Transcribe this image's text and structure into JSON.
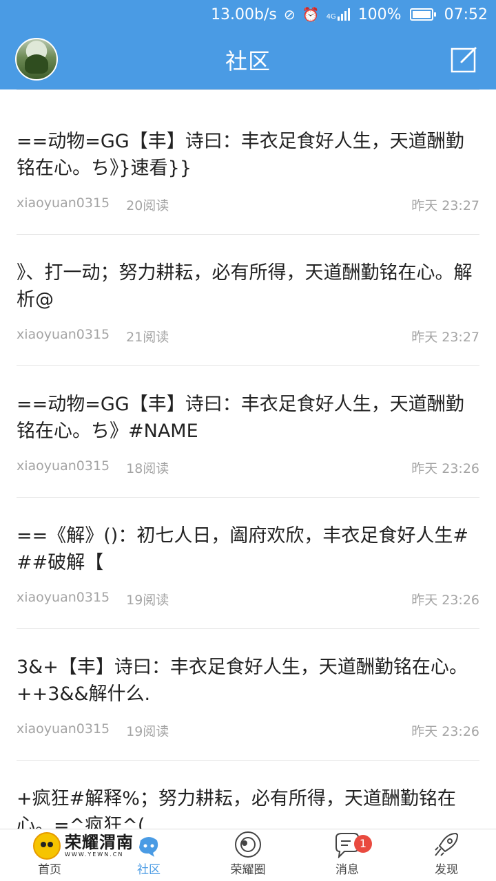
{
  "status": {
    "speed": "13.00b/s",
    "network": "4G",
    "battery": "100%",
    "time": "07:52",
    "battery_level": 1.0
  },
  "header": {
    "title": "社区"
  },
  "posts": [
    {
      "title": "==动物=GG【丰】诗曰：丰衣足食好人生，天道酬勤铭在心。ち》}速看}}",
      "author": "xiaoyuan0315",
      "reads": "20阅读",
      "time": "昨天 23:27"
    },
    {
      "title": "》、打一动；努力耕耘，必有所得，天道酬勤铭在心。解析@",
      "author": "xiaoyuan0315",
      "reads": "21阅读",
      "time": "昨天 23:27"
    },
    {
      "title": "==动物=GG【丰】诗曰：丰衣足食好人生，天道酬勤铭在心。ち》#NAME",
      "author": "xiaoyuan0315",
      "reads": "18阅读",
      "time": "昨天 23:26"
    },
    {
      "title": "==《解》()：初七人日，阖府欢欣，丰衣足食好人生###破解【",
      "author": "xiaoyuan0315",
      "reads": "19阅读",
      "time": "昨天 23:26"
    },
    {
      "title": "3&+【丰】诗曰：丰衣足食好人生，天道酬勤铭在心。++3&&解什么.",
      "author": "xiaoyuan0315",
      "reads": "19阅读",
      "time": "昨天 23:26"
    },
    {
      "title": "+疯狂#解释%；努力耕耘，必有所得，天道酬勤铭在心。=^疯狂^(",
      "author": "",
      "reads": "",
      "time": ""
    }
  ],
  "tabs": [
    {
      "label": "首页",
      "icon": "home-icon"
    },
    {
      "label": "社区",
      "icon": "community-icon"
    },
    {
      "label": "荣耀圈",
      "icon": "circle-icon"
    },
    {
      "label": "消息",
      "icon": "message-icon",
      "badge": "1"
    },
    {
      "label": "发现",
      "icon": "rocket-icon"
    }
  ],
  "brand": {
    "name": "荣耀渭南",
    "url": "WWW.YEWN.CN"
  },
  "colors": {
    "primary": "#4a9be4",
    "badge": "#e94a3f",
    "meta": "#a4a4a4"
  }
}
